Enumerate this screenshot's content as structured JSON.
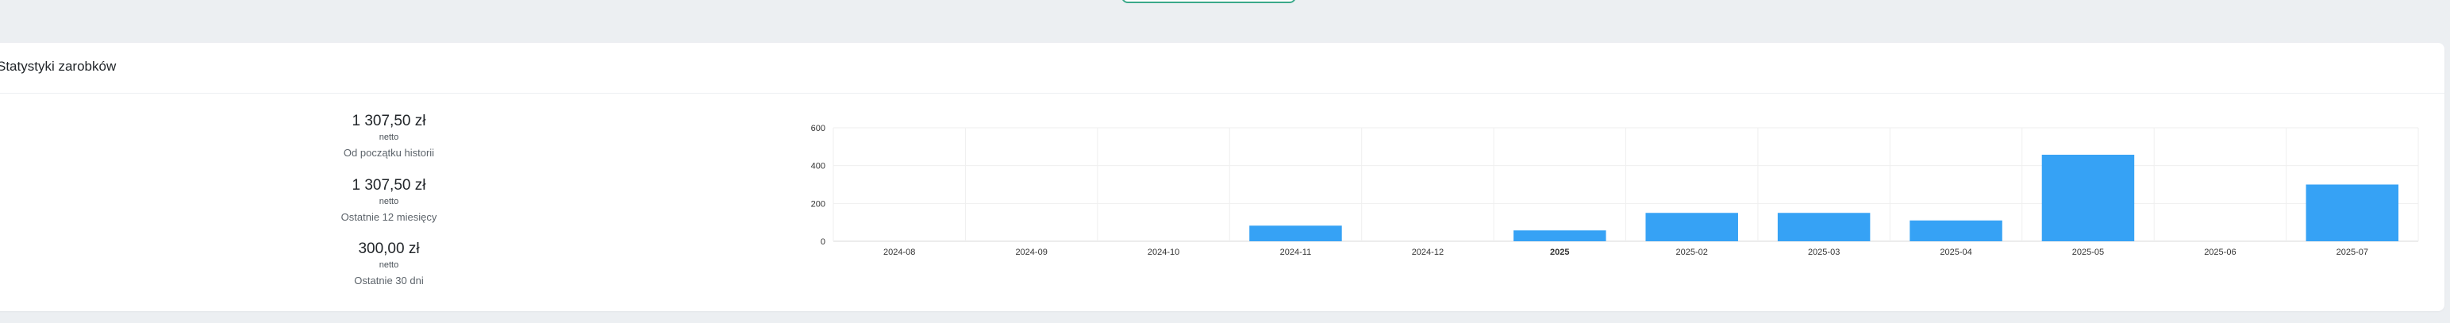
{
  "card": {
    "title": "Statystyki zarobków"
  },
  "stats": [
    {
      "amount": "1 307,50 zł",
      "unit": "netto",
      "desc": "Od początku historii"
    },
    {
      "amount": "1 307,50 zł",
      "unit": "netto",
      "desc": "Ostatnie 12 miesięcy"
    },
    {
      "amount": "300,00 zł",
      "unit": "netto",
      "desc": "Ostatnie 30 dni"
    }
  ],
  "colors": {
    "bar": "#36a2f5",
    "accent_button_border": "#3aa98a"
  },
  "chart_data": {
    "type": "bar",
    "categories": [
      "2024-08",
      "2024-09",
      "2024-10",
      "2024-11",
      "2024-12",
      "2025",
      "2025-02",
      "2025-03",
      "2025-04",
      "2025-05",
      "2025-06",
      "2025-07"
    ],
    "bold_categories": [
      "2025"
    ],
    "values": [
      0,
      0,
      0,
      82.5,
      0,
      57.5,
      150,
      150,
      110,
      457.5,
      0,
      300
    ],
    "ylim": [
      0,
      600
    ],
    "yticks": [
      0,
      200,
      400,
      600
    ],
    "grid": true,
    "legend": "none"
  }
}
